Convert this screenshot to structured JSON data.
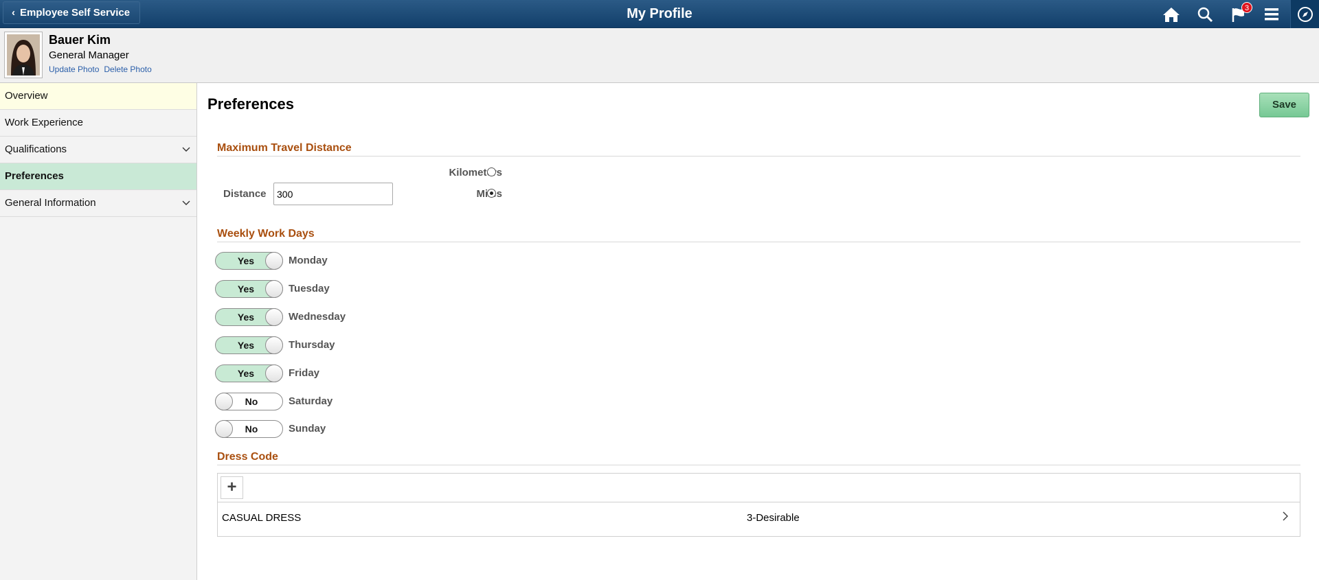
{
  "banner": {
    "back_label": "Employee Self Service",
    "title": "My Profile",
    "notifications_count": "3",
    "icons": [
      "home-icon",
      "search-icon",
      "notifications-flag-icon",
      "actions-menu-icon",
      "navbar-compass-icon"
    ]
  },
  "profile": {
    "name": "Bauer Kim",
    "job_title": "General Manager",
    "update_photo": "Update Photo",
    "delete_photo": "Delete Photo"
  },
  "sidebar": {
    "items": [
      {
        "label": "Overview",
        "expandable": false
      },
      {
        "label": "Work Experience",
        "expandable": false
      },
      {
        "label": "Qualifications",
        "expandable": true
      },
      {
        "label": "Preferences",
        "expandable": false,
        "selected": true
      },
      {
        "label": "General Information",
        "expandable": true
      }
    ]
  },
  "main": {
    "title": "Preferences",
    "save_label": "Save",
    "travel": {
      "title": "Maximum Travel Distance",
      "distance_label": "Distance",
      "distance_value": "300",
      "kilometers_label": "Kilometers",
      "miles_label": "Miles",
      "selected_unit": "Miles"
    },
    "workdays": {
      "title": "Weekly Work Days",
      "days": [
        {
          "day": "Monday",
          "state": "Yes"
        },
        {
          "day": "Tuesday",
          "state": "Yes"
        },
        {
          "day": "Wednesday",
          "state": "Yes"
        },
        {
          "day": "Thursday",
          "state": "Yes"
        },
        {
          "day": "Friday",
          "state": "Yes"
        },
        {
          "day": "Saturday",
          "state": "No"
        },
        {
          "day": "Sunday",
          "state": "No"
        }
      ]
    },
    "dress_code": {
      "title": "Dress Code",
      "add_label": "+",
      "rows": [
        {
          "code": "CASUAL DRESS",
          "rating": "3-Desirable"
        }
      ]
    }
  },
  "colors": {
    "banner": "#1a4772",
    "accent_green": "#c9e9d6",
    "group_title": "#a94f0f",
    "link": "#2a5ea9"
  }
}
